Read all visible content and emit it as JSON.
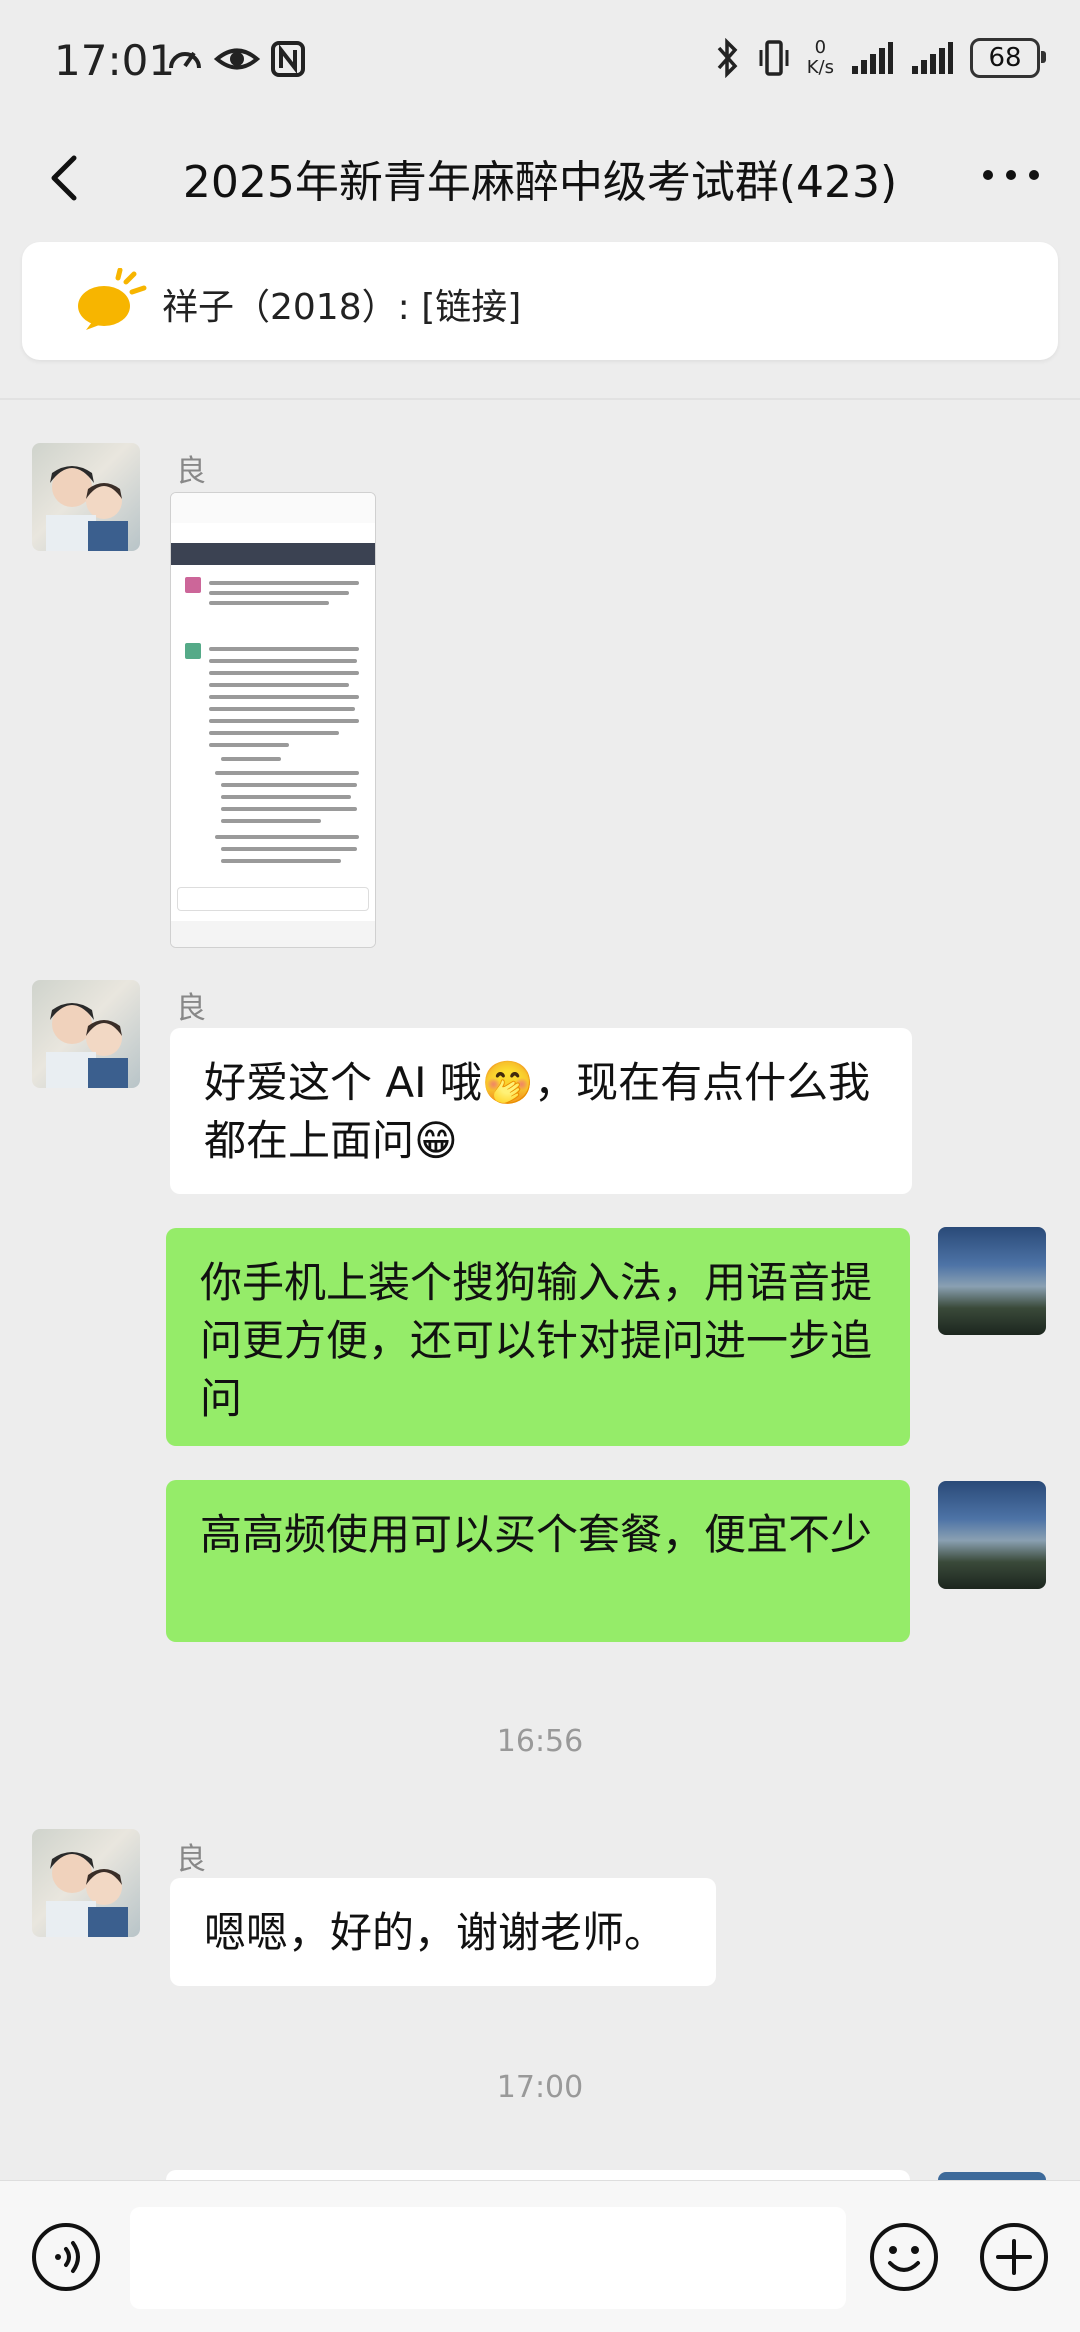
{
  "status_bar": {
    "time": "17:01",
    "net_speed_value": "0",
    "net_speed_unit": "K/s",
    "battery": "68",
    "icons": [
      "speedometer-icon",
      "eye-icon",
      "nfc-icon",
      "bluetooth-icon",
      "vibrate-icon",
      "signal-icon",
      "signal-icon"
    ]
  },
  "header": {
    "title": "2025年新青年麻醉中级考试群(423)",
    "back_icon": "chevron-left-icon",
    "more_icon": "more-dots-icon"
  },
  "pinned": {
    "icon": "announcement-icon",
    "text": "祥子（2018）: [链接]"
  },
  "messages": [
    {
      "sender": "良",
      "type": "image",
      "direction": "in"
    },
    {
      "sender": "良",
      "type": "text",
      "direction": "in",
      "text": "好爱这个 AI 哦🤭，现在有点什么我都在上面问😁"
    },
    {
      "type": "text",
      "direction": "out",
      "text": "你手机上装个搜狗输入法，用语音提问更方便，还可以针对提问进一步追问"
    },
    {
      "type": "text",
      "direction": "out",
      "text": "高高频使用可以买个套餐，便宜不少"
    },
    {
      "type": "time",
      "text": "16:56"
    },
    {
      "sender": "良",
      "type": "text",
      "direction": "in",
      "text": "嗯嗯，好的，谢谢老师。"
    },
    {
      "type": "time",
      "text": "17:00"
    }
  ],
  "input_bar": {
    "voice_icon": "voice-icon",
    "emoji_icon": "emoji-icon",
    "plus_icon": "plus-icon",
    "value": ""
  },
  "colors": {
    "background": "#ededed",
    "outgoing_bubble": "#95ec69",
    "incoming_bubble": "#ffffff"
  }
}
